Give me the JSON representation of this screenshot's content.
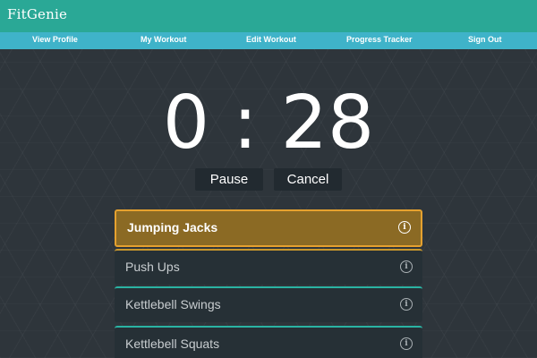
{
  "app": {
    "title": "FitGenie"
  },
  "nav": {
    "items": [
      {
        "label": "View Profile"
      },
      {
        "label": "My Workout"
      },
      {
        "label": "Edit Workout"
      },
      {
        "label": "Progress Tracker"
      },
      {
        "label": "Sign Out"
      }
    ]
  },
  "timer": {
    "display": "0 : 28"
  },
  "controls": {
    "pause_label": "Pause",
    "cancel_label": "Cancel"
  },
  "exercises": [
    {
      "name": "Jumping Jacks",
      "state": "active"
    },
    {
      "name": "Push Ups",
      "state": "next"
    },
    {
      "name": "Kettlebell Swings",
      "state": "pending"
    },
    {
      "name": "Kettlebell Squats",
      "state": "pending"
    }
  ],
  "colors": {
    "header": "#2aa896",
    "nav": "#3fb3c9",
    "active_item": "#8b6a24",
    "active_border": "#e5a12f",
    "background": "#2e353b"
  },
  "icons": {
    "info": "info-circle-icon"
  }
}
